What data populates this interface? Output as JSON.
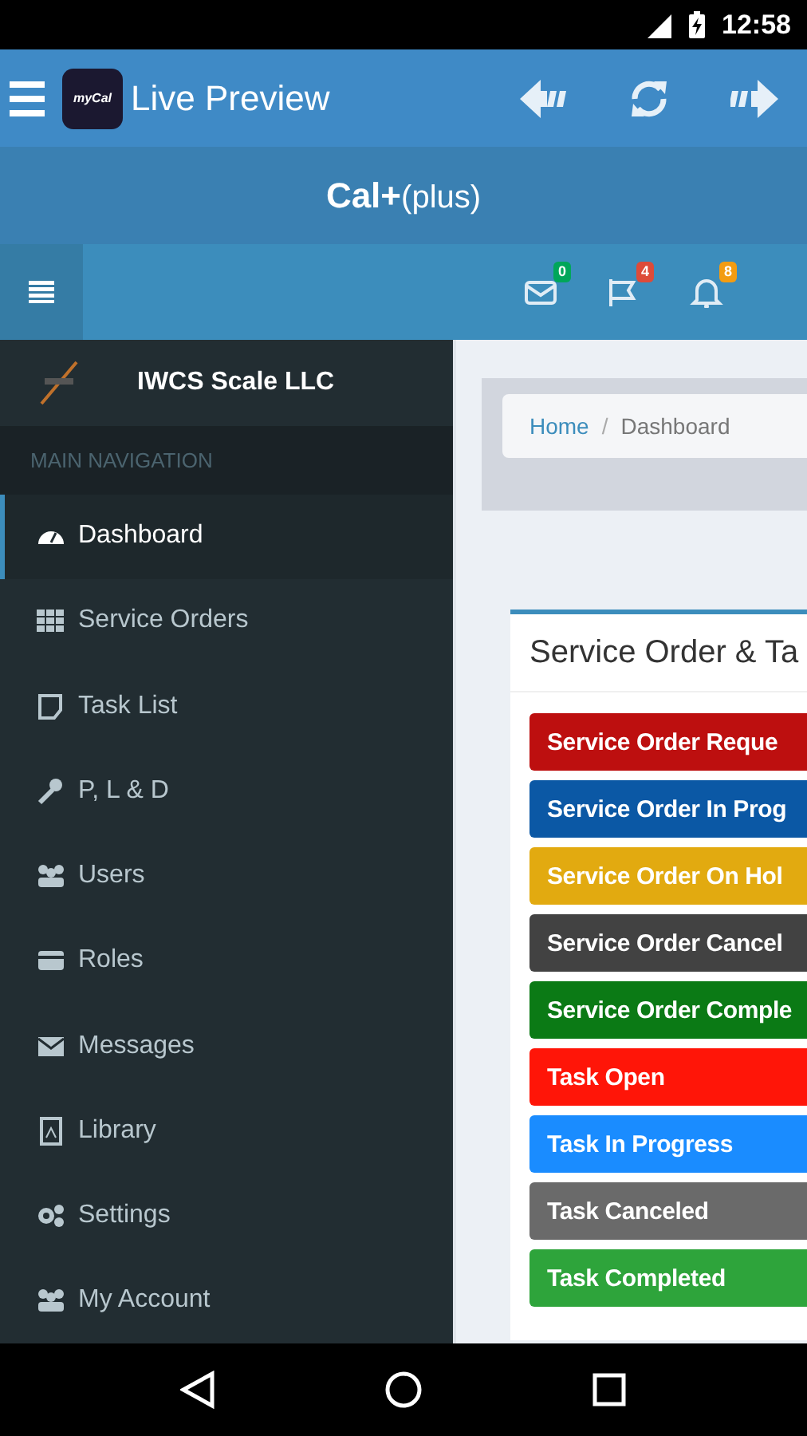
{
  "status_bar": {
    "time": "12:58"
  },
  "app_bar": {
    "logo": "myCal",
    "title": "Live Preview"
  },
  "header": {
    "brand": "Cal+",
    "brand_suffix": "(plus)"
  },
  "navbar": {
    "badges": [
      {
        "kind": "mail",
        "count": "0",
        "color": "#00a65a"
      },
      {
        "kind": "flag",
        "count": "4",
        "color": "#dd4b39"
      },
      {
        "kind": "bell",
        "count": "8",
        "color": "#f39c12"
      }
    ]
  },
  "sidebar": {
    "company": "IWCS Scale LLC",
    "section": "MAIN NAVIGATION",
    "items": [
      {
        "label": "Dashboard",
        "kind": "dashboard",
        "selected": true
      },
      {
        "label": "Service Orders",
        "kind": "grid",
        "selected": false
      },
      {
        "label": "Task List",
        "kind": "note",
        "selected": false
      },
      {
        "label": "P, L & D",
        "kind": "wrench",
        "selected": false
      },
      {
        "label": "Users",
        "kind": "users",
        "selected": false
      },
      {
        "label": "Roles",
        "kind": "card",
        "selected": false
      },
      {
        "label": "Messages",
        "kind": "mail",
        "selected": false
      },
      {
        "label": "Library",
        "kind": "file",
        "selected": false
      },
      {
        "label": "Settings",
        "kind": "gears",
        "selected": false
      },
      {
        "label": "My Account",
        "kind": "users",
        "selected": false
      }
    ]
  },
  "breadcrumb": {
    "separator": "/",
    "crumbs": [
      "Home",
      "Dashboard"
    ]
  },
  "panel": {
    "title": "Service Order & Ta",
    "legend": [
      {
        "label": "Service Order Reque",
        "color": "#bd0f0f"
      },
      {
        "label": "Service Order In Prog",
        "color": "#0b58a5"
      },
      {
        "label": "Service Order On Hol",
        "color": "#e2aa10"
      },
      {
        "label": "Service Order Cancel",
        "color": "#424242"
      },
      {
        "label": "Service Order Comple",
        "color": "#0b7a15"
      },
      {
        "label": "Task Open",
        "color": "#ff1508"
      },
      {
        "label": "Task In Progress",
        "color": "#1a8cff"
      },
      {
        "label": "Task Canceled",
        "color": "#6a6a6a"
      },
      {
        "label": "Task Completed",
        "color": "#2ea43b"
      }
    ]
  }
}
